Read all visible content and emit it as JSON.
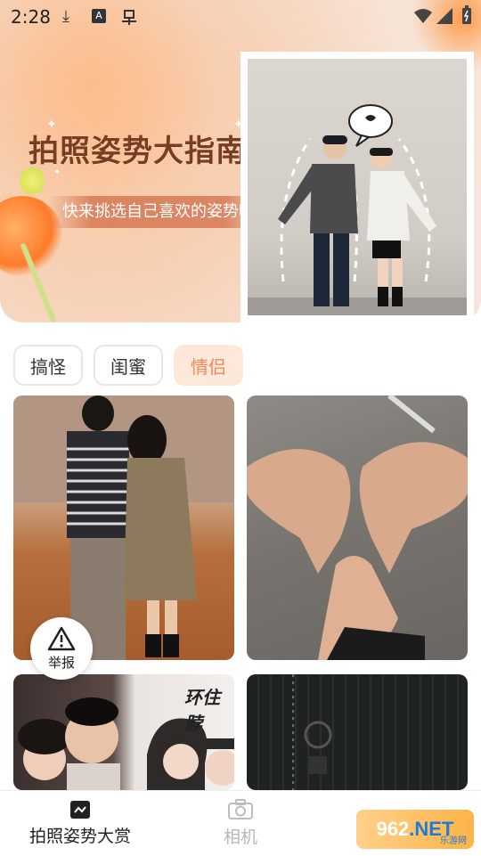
{
  "status_bar": {
    "time": "2:28",
    "icons": [
      "download-icon",
      "a-badge-icon",
      "bug-icon",
      "wifi-icon",
      "signal-icon",
      "battery-icon"
    ],
    "a_badge_text": "A"
  },
  "hero": {
    "title": "拍照姿势大指南",
    "subtitle": "快来挑选自己喜欢的姿势吧"
  },
  "filters": {
    "items": [
      {
        "label": "搞怪",
        "active": false
      },
      {
        "label": "闺蜜",
        "active": false
      },
      {
        "label": "情侣",
        "active": true
      }
    ],
    "accent": "#f28a5a",
    "accent_bg": "#fde8d9"
  },
  "grid": {
    "cards": [
      "couple-beach-photo",
      "hand-heart-photo",
      "couple-selfie-photo",
      "dark-door-photo"
    ],
    "card3_overlay_text": "环住脖"
  },
  "report_button": {
    "label": "举报"
  },
  "bottom_nav": {
    "items": [
      {
        "label": "拍照姿势大赏",
        "active": true
      },
      {
        "label": "相机",
        "active": false
      }
    ]
  },
  "watermark": {
    "brand_number": "962",
    "brand_tld": ".NET",
    "brand_sub": "乐游网"
  }
}
